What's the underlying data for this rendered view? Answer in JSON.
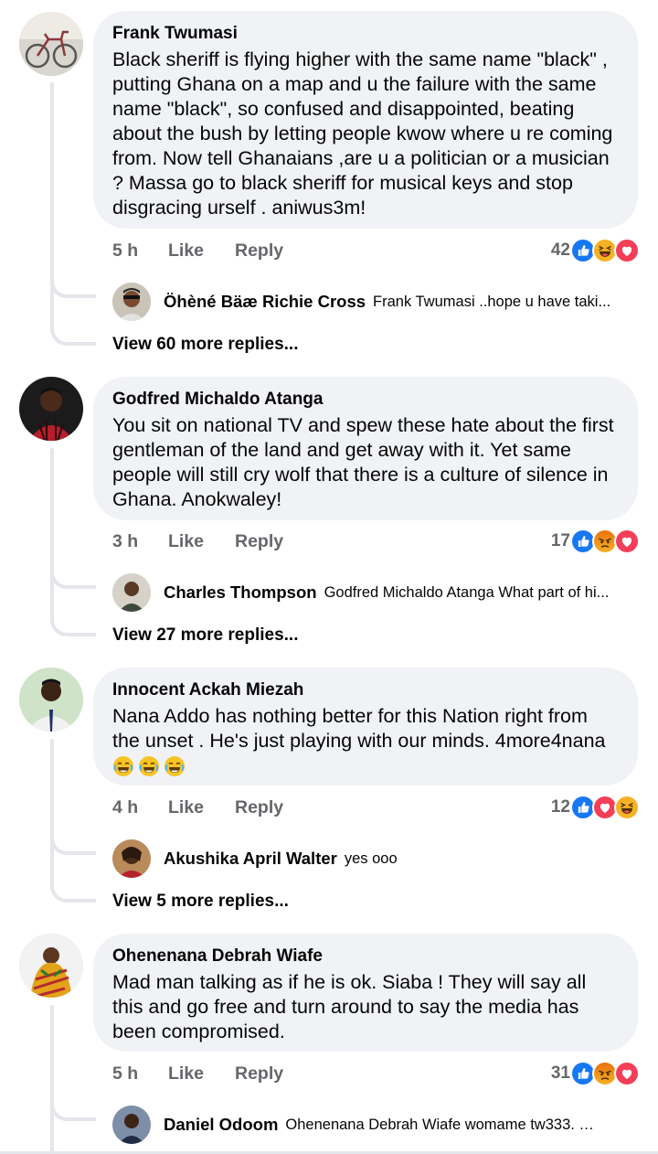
{
  "comments": [
    {
      "author": "Frank Twumasi",
      "text": "Black sheriff is flying higher with the same name \"black\" , putting Ghana on a map and u the failure with the same name \"black\", so confused and disappointed, beating about the bush by letting people kwow where u re coming from. Now tell Ghanaians ,are u  a politician or a musician ?  Massa go to black sheriff for musical keys and stop disgracing urself . aniwus3m!",
      "time": "5 h",
      "like_label": "Like",
      "reply_label": "Reply",
      "reaction_count": "42",
      "reactions": [
        "like",
        "haha",
        "love"
      ],
      "reply": {
        "author": "Öhèné Bäæ Richie Cross",
        "text": "Frank Twumasi ..hope u have taki..."
      },
      "view_more": "View 60 more replies..."
    },
    {
      "author": "Godfred Michaldo Atanga",
      "text": "You sit on national TV and spew these hate about the first gentleman of the land and get away with it. Yet same people will still cry wolf that there is a culture of silence in Ghana. Anokwaley!",
      "time": "3 h",
      "like_label": "Like",
      "reply_label": "Reply",
      "reaction_count": "17",
      "reactions": [
        "like",
        "angry",
        "love"
      ],
      "reply": {
        "author": "Charles Thompson",
        "text": "Godfred Michaldo Atanga What part of hi..."
      },
      "view_more": "View 27 more replies..."
    },
    {
      "author": "Innocent Ackah Miezah",
      "text": "Nana Addo has nothing better for this Nation right from the unset . He's just playing with our minds. 4more4nana",
      "emojis": [
        "joy-emoji",
        "joy-emoji",
        "joy-emoji"
      ],
      "time": "4 h",
      "like_label": "Like",
      "reply_label": "Reply",
      "reaction_count": "12",
      "reactions": [
        "like",
        "love",
        "haha"
      ],
      "reply": {
        "author": "Akushika April Walter",
        "text": "yes ooo"
      },
      "view_more": "View 5 more replies..."
    },
    {
      "author": "Ohenenana Debrah Wiafe",
      "text": "Mad man talking as if he is ok. Siaba ! They will say all this and go free and turn around to say the media has been compromised.",
      "time": "5 h",
      "like_label": "Like",
      "reply_label": "Reply",
      "reaction_count": "31",
      "reactions": [
        "like",
        "angry",
        "love"
      ],
      "reply": {
        "author": "Daniel Odoom",
        "text": "Ohenenana Debrah Wiafe womame tw333. K..."
      }
    }
  ],
  "colors": {
    "bubble": "#f0f2f5",
    "meta_text": "#65676b",
    "like_blue": "#1877f2",
    "love_red": "#f33e58",
    "haha_yellow": "#f7b125",
    "angry_orange": "#e9710f",
    "thread_line": "#e4e6eb"
  }
}
